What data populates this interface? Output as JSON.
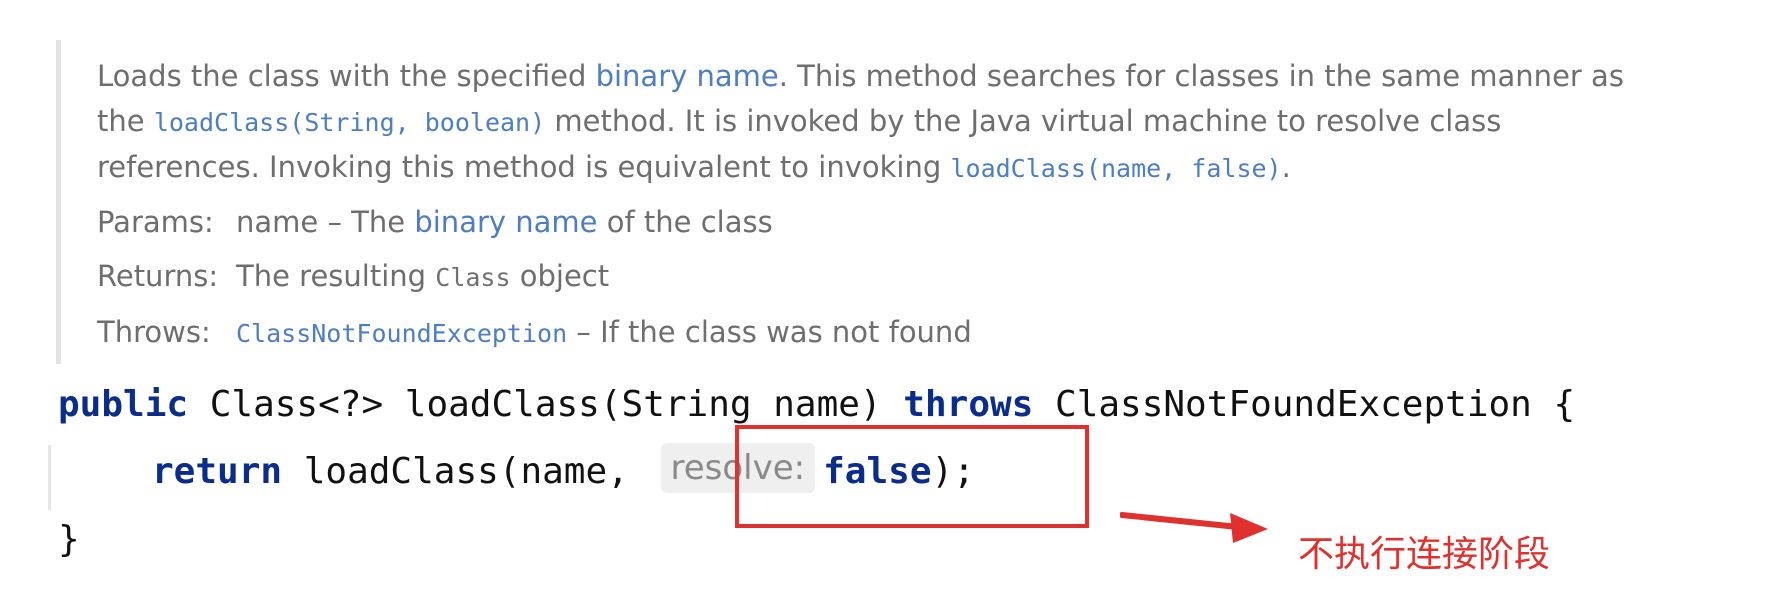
{
  "javadoc": {
    "desc_part1": "Loads the class with the specified ",
    "desc_link1": "binary name",
    "desc_part2": ". This method searches for classes in the same manner as the ",
    "desc_code1": "loadClass(String, boolean)",
    "desc_part3": " method. It is invoked by the Java virtual machine to resolve class references. Invoking this method is equivalent to invoking ",
    "desc_code2": "loadClass(name, false)",
    "desc_part4": ".",
    "params_label": "Params:",
    "params_text1": "name – The ",
    "params_link": "binary name",
    "params_text2": " of the class",
    "returns_label": "Returns:",
    "returns_text1": "The resulting ",
    "returns_code": "Class",
    "returns_text2": " object",
    "throws_label": "Throws:",
    "throws_link": "ClassNotFoundException",
    "throws_text": " – If the class was not found"
  },
  "code": {
    "line1_kw1": "public",
    "line1_text1": " Class<?> loadClass(String name) ",
    "line1_kw2": "throws",
    "line1_text2": " ClassNotFoundException {",
    "line2_kw": "return",
    "line2_text1": " loadClass(name, ",
    "line2_hint": "resolve:",
    "line2_kw2": "false",
    "line2_text2": ");",
    "line3": "}"
  },
  "annotation": {
    "note": "不执行连接阶段",
    "color": "#e0312e"
  }
}
